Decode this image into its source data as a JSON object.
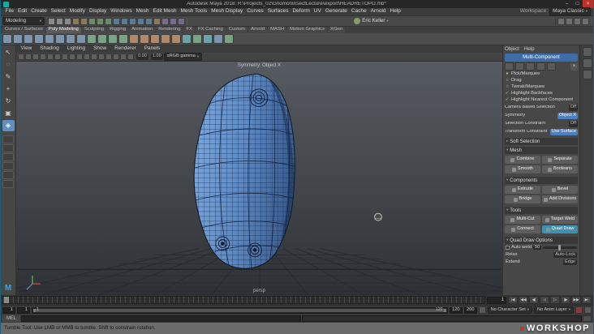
{
  "window": {
    "title": "Autodesk Maya 2018: R:\\Projects_02\\GnomonInsectLecture\\export\\HEADRETOPO.mb*",
    "minimize": "–",
    "maximize": "□",
    "close": "×"
  },
  "ui": {
    "caret_down": "▾",
    "caret_right": "▸"
  },
  "branding": {
    "maya_logo": "M"
  },
  "menubar": {
    "items": [
      "File",
      "Edit",
      "Create",
      "Select",
      "Modify",
      "Display",
      "Windows",
      "Mesh",
      "Edit Mesh",
      "Mesh Tools",
      "Mesh Display",
      "Curves",
      "Surfaces",
      "Deform",
      "UV",
      "Generate",
      "Cache",
      "Arnold",
      "Help"
    ],
    "workspace_label": "Workspace:",
    "workspace_value": "Maya Classic"
  },
  "statusline": {
    "mode": "Modeling",
    "user": "Eric Keller",
    "icons": [
      {
        "name": "new-scene-icon",
        "k": "file"
      },
      {
        "name": "open-scene-icon",
        "k": "file"
      },
      {
        "name": "save-scene-icon",
        "k": "file"
      },
      {
        "name": "undo-icon",
        "k": "hist"
      },
      {
        "name": "redo-icon",
        "k": "hist"
      },
      {
        "name": "select-by-hierarchy-icon",
        "k": "sel"
      },
      {
        "name": "select-by-object-icon",
        "k": "sel"
      },
      {
        "name": "select-by-component-icon",
        "k": "sel"
      },
      {
        "name": "snap-to-grid-icon",
        "k": "snap"
      },
      {
        "name": "snap-to-curve-icon",
        "k": "snap"
      },
      {
        "name": "snap-to-point-icon",
        "k": "snap"
      },
      {
        "name": "snap-to-plane-icon",
        "k": "snap"
      },
      {
        "name": "make-live-icon",
        "k": "snap"
      },
      {
        "name": "construction-history-icon",
        "k": "hist"
      },
      {
        "name": "render-icon",
        "k": "render"
      },
      {
        "name": "ipr-render-icon",
        "k": "render"
      },
      {
        "name": "render-settings-icon",
        "k": "render"
      }
    ],
    "right_icons": [
      {
        "name": "raise-panels-icon"
      },
      {
        "name": "attribute-editor-toggle-icon"
      },
      {
        "name": "tool-settings-toggle-icon"
      },
      {
        "name": "channel-box-toggle-icon"
      }
    ]
  },
  "shelf": {
    "active_index": 1,
    "tabs": [
      "Curves / Surfaces",
      "Poly Modeling",
      "Sculpting",
      "Rigging",
      "Animation",
      "Rendering",
      "FX",
      "FX Caching",
      "Custom",
      "Arnold",
      "MASH",
      "Motion Graphics",
      "XGen"
    ],
    "icons": [
      {
        "name": "poly-sphere-icon",
        "k": "b"
      },
      {
        "name": "poly-cube-icon",
        "k": "b"
      },
      {
        "name": "poly-cylinder-icon",
        "k": "b"
      },
      {
        "name": "poly-cone-icon",
        "k": "b"
      },
      {
        "name": "poly-torus-icon",
        "k": "b"
      },
      {
        "name": "poly-plane-icon",
        "k": "b"
      },
      {
        "name": "poly-disc-icon",
        "k": "b"
      },
      {
        "name": "platonic-solid-icon",
        "k": "b"
      },
      {
        "name": "combine-icon",
        "k": "g"
      },
      {
        "name": "separate-icon",
        "k": "g"
      },
      {
        "name": "smooth-icon",
        "k": "g"
      },
      {
        "name": "boolean-icon",
        "k": "g"
      },
      {
        "name": "extrude-icon",
        "k": "o"
      },
      {
        "name": "bevel-icon",
        "k": "o"
      },
      {
        "name": "bridge-icon",
        "k": "o"
      },
      {
        "name": "multi-cut-icon",
        "k": "o"
      },
      {
        "name": "target-weld-icon",
        "k": "o"
      },
      {
        "name": "quad-draw-icon",
        "k": "t"
      },
      {
        "name": "mirror-icon",
        "k": "g"
      },
      {
        "name": "sculpt-icon",
        "k": "t"
      },
      {
        "name": "uv-editor-icon",
        "k": "b"
      },
      {
        "name": "normals-icon",
        "k": "g"
      }
    ]
  },
  "toolbox": {
    "active_index": 6,
    "tools": [
      {
        "name": "select-tool-icon",
        "glyph": "↖"
      },
      {
        "name": "lasso-tool-icon",
        "glyph": "◌"
      },
      {
        "name": "paint-select-tool-icon",
        "glyph": "✎"
      },
      {
        "name": "move-tool-icon",
        "glyph": "+"
      },
      {
        "name": "rotate-tool-icon",
        "glyph": "↻"
      },
      {
        "name": "scale-tool-icon",
        "glyph": "▣"
      },
      {
        "name": "current-tool-icon",
        "glyph": "◈"
      }
    ],
    "layouts": [
      {
        "name": "layout-single-pane-icon"
      },
      {
        "name": "layout-four-pane-icon"
      },
      {
        "name": "layout-two-pane-icon"
      },
      {
        "name": "layout-persp-outliner-icon"
      },
      {
        "name": "layout-hypershade-icon"
      },
      {
        "name": "layout-uv-icon"
      }
    ]
  },
  "viewport": {
    "menus": [
      "View",
      "Shading",
      "Lighting",
      "Show",
      "Renderer",
      "Panels"
    ],
    "icons": [
      {
        "name": "select-camera-icon"
      },
      {
        "name": "lock-camera-icon"
      },
      {
        "name": "camera-attributes-icon"
      },
      {
        "name": "bookmark-icon"
      },
      {
        "name": "image-plane-icon"
      },
      {
        "name": "two-d-pan-zoom-icon"
      },
      {
        "name": "grease-pencil-icon"
      },
      {
        "name": "grid-icon"
      },
      {
        "name": "film-gate-icon"
      },
      {
        "name": "resolution-gate-icon"
      },
      {
        "name": "gate-mask-icon"
      },
      {
        "name": "field-chart-icon"
      },
      {
        "name": "safe-action-icon"
      },
      {
        "name": "safe-title-icon"
      },
      {
        "name": "isolate-select-icon"
      },
      {
        "name": "xray-icon"
      }
    ],
    "exposure": "0.00",
    "gamma": "1.00",
    "view_transform": "sRGB gamma",
    "overlay_symmetry": "Symmetry: Object X",
    "camera_label": "persp"
  },
  "toolkit": {
    "menus": [
      "Object",
      "Help"
    ],
    "multi_component": "Multi-Component",
    "close": "×",
    "component_icons": [
      {
        "name": "object-mode-icon"
      },
      {
        "name": "vertex-mode-icon"
      },
      {
        "name": "edge-mode-icon"
      },
      {
        "name": "face-mode-icon"
      },
      {
        "name": "uv-mode-icon"
      }
    ],
    "options": [
      {
        "mark": "●",
        "label": "Pick/Marquee"
      },
      {
        "mark": "○",
        "label": "Drag"
      },
      {
        "mark": "○",
        "label": "Tweak/Marquee"
      },
      {
        "mark": "✓",
        "label": "Highlight Backfaces"
      },
      {
        "mark": "✓",
        "label": "Highlight Nearest Component"
      }
    ],
    "selection_rows": [
      {
        "label": "Camera Based Selection",
        "value": "Off"
      },
      {
        "label": "Symmetry",
        "value": "Object X"
      },
      {
        "label": "Selection Constraint",
        "value": "Off"
      },
      {
        "label": "Transform Constraint",
        "value": "Use Surface"
      }
    ],
    "soft_selection_title": "Soft Selection",
    "mesh_title": "Mesh",
    "mesh_buttons": [
      "Combine",
      "Separate",
      "Smooth",
      "Booleans"
    ],
    "components_title": "Components",
    "components_buttons": [
      "Extrude",
      "Bevel",
      "Bridge",
      "Add Divisions"
    ],
    "tools_title": "Tools",
    "tools_buttons": [
      "Multi-Cut",
      "Target Weld",
      "Connect",
      "Quad Draw"
    ],
    "tools_active_index": 3,
    "quad_title": "Quad Draw Options",
    "auto_weld_label": "Auto weld",
    "auto_weld_value": "50",
    "relax_label": "Relax",
    "relax_value": "Auto-Lock",
    "extend_label": "Extend",
    "extend_value": "Edge"
  },
  "sidebar": {
    "icons": [
      {
        "name": "channel-box-tab-icon"
      },
      {
        "name": "modeling-toolkit-tab-icon"
      },
      {
        "name": "attribute-editor-tab-icon"
      }
    ]
  },
  "timeline": {
    "current": "1",
    "transport": [
      {
        "name": "go-to-start-button",
        "glyph": "|◀"
      },
      {
        "name": "step-back-frame-button",
        "glyph": "◀◀"
      },
      {
        "name": "step-back-key-button",
        "glyph": "◀|"
      },
      {
        "name": "play-backwards-button",
        "glyph": "◁"
      },
      {
        "name": "play-forward-button",
        "glyph": "▷"
      },
      {
        "name": "step-forward-key-button",
        "glyph": "|▶"
      },
      {
        "name": "step-forward-frame-button",
        "glyph": "▶▶"
      },
      {
        "name": "go-to-end-button",
        "glyph": "▶|"
      }
    ],
    "range_start_outer": "1",
    "range_start": "1",
    "range_end": "120",
    "range_end_outer": "200",
    "bar_label_left": "1",
    "bar_label_right": "120",
    "character_set": "No Character Set",
    "anim_layer": "No Anim Layer"
  },
  "command": {
    "label": "MEL"
  },
  "helpline": {
    "text": "Tumble Tool: Use LMB or MMB to tumble. Shift to constrain rotation."
  },
  "watermark": {
    "text": "WORKSHOP"
  }
}
